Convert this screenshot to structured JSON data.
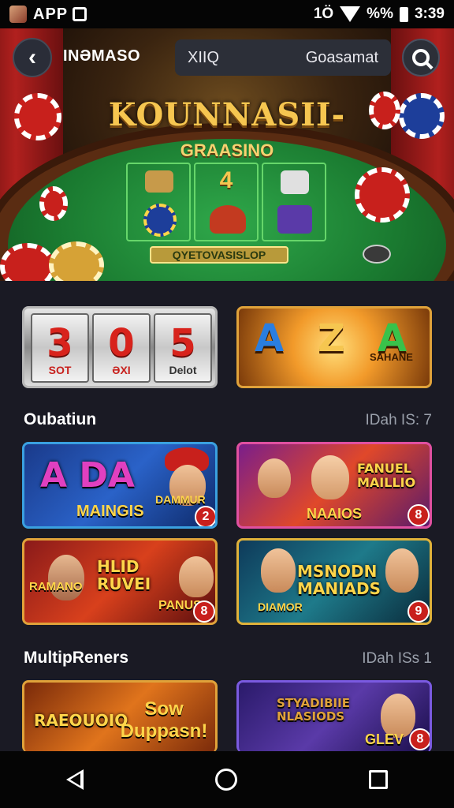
{
  "status_bar": {
    "app_label": "APP",
    "icons": [
      "app-icon",
      "square-icon",
      "vibrate-icon",
      "wifi-icon",
      "battery-icon"
    ],
    "signal_text": "1Ö",
    "battery_text": "%%",
    "time": "3:39"
  },
  "header": {
    "back_icon": "chevron-left-icon",
    "title": "INƏMASO",
    "search": {
      "value": "XIIQ",
      "placeholder": "Goasamat"
    },
    "search_icon": "search-icon"
  },
  "hero": {
    "title": "KOUNNASII-",
    "subtitle": "GRAASINO",
    "card_values": [
      "",
      "4",
      ""
    ],
    "plate": "QYETOVASISLOP"
  },
  "featured": [
    {
      "type": "slot",
      "reels": [
        {
          "value": "3",
          "caption": "SOT"
        },
        {
          "value": "0",
          "caption": "ƏXI"
        },
        {
          "value": "5",
          "caption": "Delot"
        }
      ]
    },
    {
      "type": "slot",
      "letters": [
        "A",
        "Z",
        "A"
      ],
      "caption": "SAHANE"
    }
  ],
  "sections": [
    {
      "title": "Oubatiun",
      "meta": "IDah IS: 7",
      "games": [
        {
          "title": "A DA",
          "sub": "MAINGIS",
          "tag": "DAMMUR",
          "badge": "2"
        },
        {
          "title": "FANUEL MAILLIO",
          "sub": "NAAIOS",
          "tag": "",
          "badge": "8"
        },
        {
          "title": "HLID RUVEI",
          "sub": "RAMANO",
          "tag": "PANUS",
          "badge": "8"
        },
        {
          "title": "MSNODN MANIADS",
          "sub": "DIAMOR",
          "tag": "",
          "badge": "9"
        }
      ]
    },
    {
      "title": "MultipRenеrs",
      "meta": "IDah ISs 1",
      "games": [
        {
          "title": "RAEOUOIO",
          "sub": "Sow Duppasn!",
          "badge": ""
        },
        {
          "title": "STYADIBIIE NLASIODS",
          "sub": "GLEV",
          "badge": "8"
        }
      ]
    }
  ],
  "nav": {
    "back_icon": "triangle-back-icon",
    "home_icon": "circle-home-icon",
    "recent_icon": "square-recent-icon"
  },
  "colors": {
    "accent_gold": "#f6c650",
    "felt": "#1a7a30",
    "bg": "#1a1a24"
  }
}
